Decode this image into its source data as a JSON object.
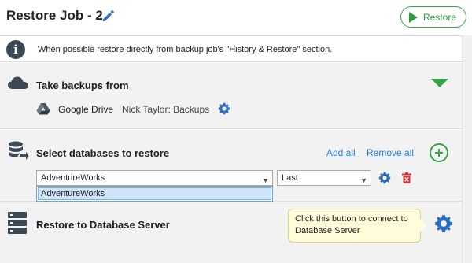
{
  "header": {
    "title": "Restore Job - 2",
    "restore_label": "Restore"
  },
  "info": {
    "text": "When possible restore directly from backup job's \"History & Restore\" section."
  },
  "backups": {
    "title": "Take backups from",
    "source": "Google Drive",
    "account": "Nick Taylor: Backups"
  },
  "databases": {
    "title": "Select databases to restore",
    "add_all": "Add all",
    "remove_all": "Remove all",
    "database_select": "AdventureWorks",
    "version_select": "Last",
    "dropdown_options": [
      "AdventureWorks"
    ]
  },
  "server": {
    "title": "Restore to Database Server",
    "tooltip": "Click this button to connect to Database Server"
  },
  "colors": {
    "accent_green": "#33a544",
    "link_blue": "#2f7bd1",
    "gear_blue": "#2e6fc0",
    "delete_red": "#d9333a"
  }
}
